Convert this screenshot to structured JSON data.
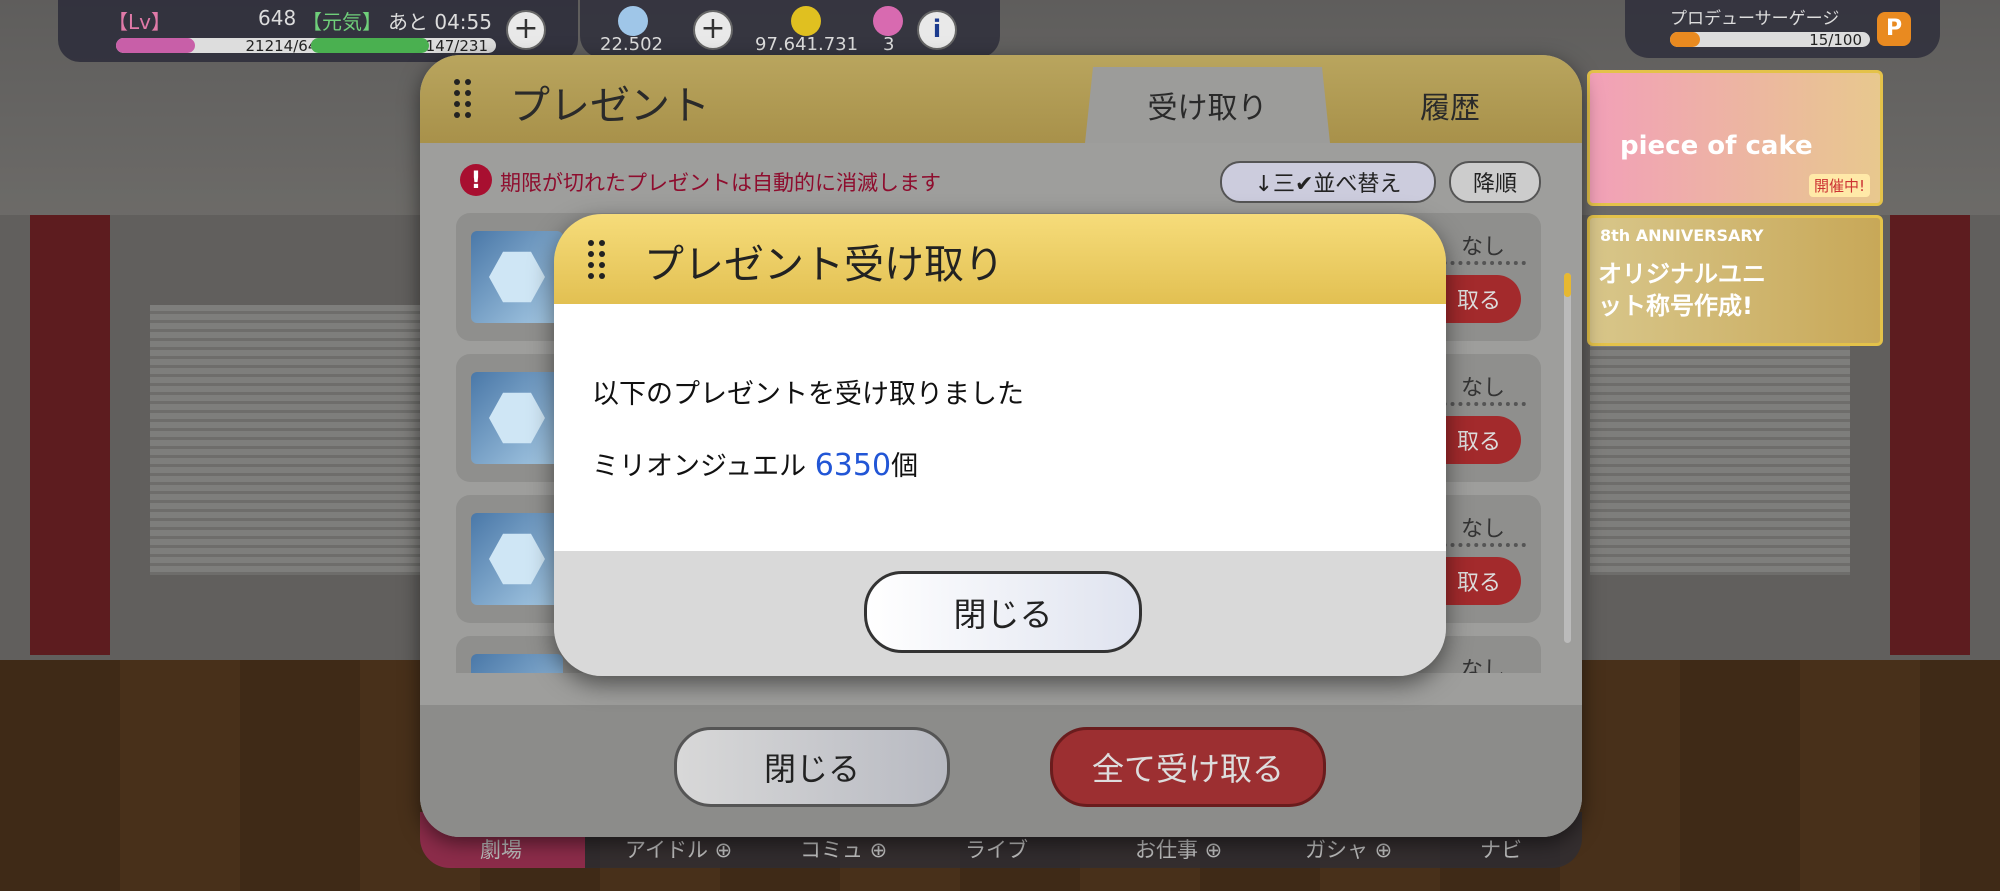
{
  "hud": {
    "level_label": "【Lv】",
    "level": "648",
    "genki_label": "【元気】",
    "timer": "あと 04:55",
    "exp": "21214/64750",
    "exp_fraction": 0.33,
    "stamina": "147/231",
    "stamina_fraction": 0.64,
    "jewels": "22.502",
    "money": "97.641.731",
    "tickets": "3",
    "plus_icon": "plus-icon",
    "info_icon": "info-icon",
    "producer_gauge_label": "プロデューサーゲージ",
    "producer_gauge": "15/100",
    "producer_gauge_fraction": 0.15,
    "p_badge": "P"
  },
  "banners": {
    "event_text": "piece of cake",
    "event_badge": "開催中!",
    "anniv_title": "8th ANNIVERSARY",
    "anniv_text": "オリジナルユニット称号作成!"
  },
  "present": {
    "title": "プレゼント",
    "tab_receive": "受け取り",
    "tab_history": "履歴",
    "warning": "期限が切れたプレゼントは自動的に消滅します",
    "warning_icon": "!",
    "sort_label": "↓三✔並べ替え",
    "order_label": "降順",
    "items": [
      {
        "expire": "なし",
        "button": "取る"
      },
      {
        "expire": "なし",
        "button": "取る"
      },
      {
        "expire": "なし",
        "button": "取る"
      },
      {
        "expire": "なし",
        "button": ""
      }
    ],
    "close_button": "閉じる",
    "receive_all_button": "全て受け取る"
  },
  "bottom_nav": [
    {
      "label": "劇場"
    },
    {
      "label": "アイドル ⊕"
    },
    {
      "label": "コミュ ⊕"
    },
    {
      "label": "ライブ"
    },
    {
      "label": "お仕事 ⊕"
    },
    {
      "label": "ガシャ ⊕"
    },
    {
      "label": "ナビ"
    }
  ],
  "modal": {
    "title": "プレゼント受け取り",
    "message": "以下のプレゼントを受け取りました",
    "item_name": "ミリオンジュエル",
    "item_count": "6350",
    "item_unit": "個",
    "close_button": "閉じる"
  },
  "colors": {
    "accent_gold": "#e2c052",
    "count_blue": "#2256d6",
    "warning_red": "#8e0d2e",
    "receive_red": "#9c2f31"
  }
}
